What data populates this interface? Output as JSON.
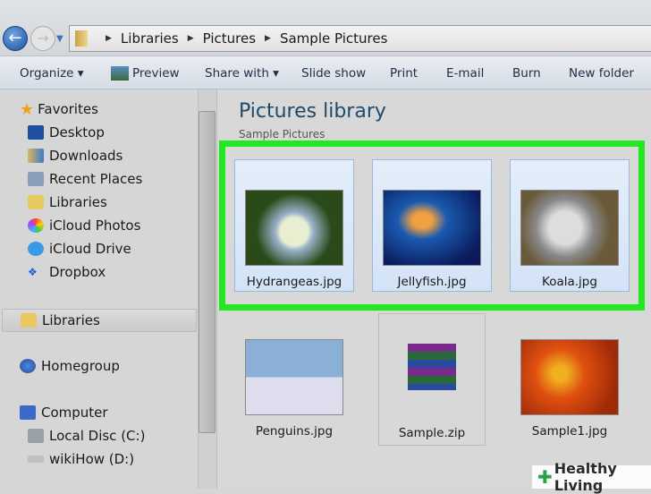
{
  "breadcrumb": [
    "Libraries",
    "Pictures",
    "Sample Pictures"
  ],
  "toolbar": {
    "organize": "Organize ▾",
    "preview": "Preview",
    "share": "Share with ▾",
    "slideshow": "Slide show",
    "print": "Print",
    "email": "E-mail",
    "burn": "Burn",
    "newfolder": "New folder"
  },
  "sidebar": {
    "favorites": "Favorites",
    "desktop": "Desktop",
    "downloads": "Downloads",
    "recent": "Recent Places",
    "libraries1": "Libraries",
    "icloudphotos": "iCloud Photos",
    "iclouddrive": "iCloud Drive",
    "dropbox": "Dropbox",
    "libraries2": "Libraries",
    "homegroup": "Homegroup",
    "computer": "Computer",
    "localc": "Local Disc (C:)",
    "wikihow": "wikiHow (D:)"
  },
  "main": {
    "title": "Pictures library",
    "subtitle": "Sample Pictures",
    "files": [
      "Hydrangeas.jpg",
      "Jellyfish.jpg",
      "Koala.jpg",
      "Penguins.jpg",
      "Sample.zip",
      "Sample1.jpg"
    ]
  },
  "watermark": "Healthy Living",
  "colors": {
    "highlight": "#22e822",
    "selected": "#d3e3f6"
  }
}
